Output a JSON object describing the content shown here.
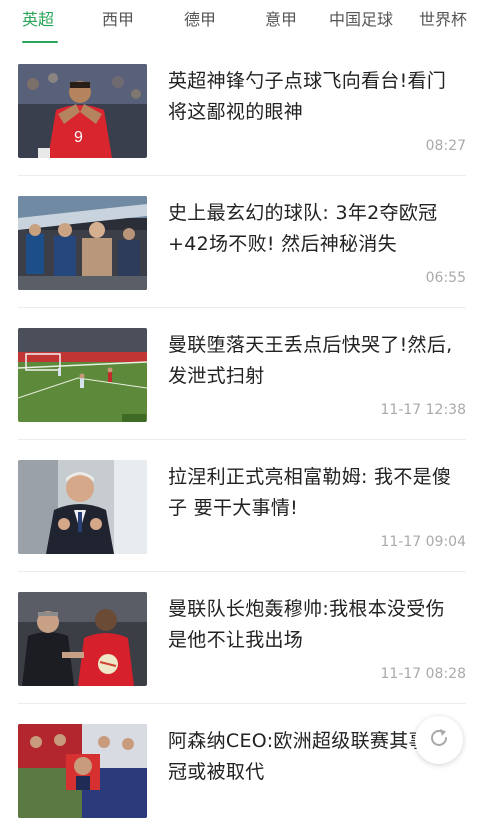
{
  "tabs": [
    {
      "label": "英超",
      "active": true
    },
    {
      "label": "西甲",
      "active": false
    },
    {
      "label": "德甲",
      "active": false
    },
    {
      "label": "意甲",
      "active": false
    },
    {
      "label": "中国足球",
      "active": false
    },
    {
      "label": "世界杯",
      "active": false
    }
  ],
  "colors": {
    "accent": "#2aa55a",
    "divider": "#ececec",
    "time": "#aaaaaa"
  },
  "articles": [
    {
      "title": "英超神锋勺子点球飞向看台!看门将这鄙视的眼神",
      "time": "08:27",
      "thumb": "player-red-jersey-9"
    },
    {
      "title": "史上最玄幻的球队: 3年2夺欧冠+42场不败! 然后神秘消失",
      "time": "06:55",
      "thumb": "coaches-bench"
    },
    {
      "title": "曼联堕落天王丢点后快哭了!然后, 发泄式扫射",
      "time": "11-17 12:38",
      "thumb": "penalty-kick-pitch"
    },
    {
      "title": "拉涅利正式亮相富勒姆: 我不是傻子 要干大事情!",
      "time": "11-17 09:04",
      "thumb": "manager-suit"
    },
    {
      "title": "曼联队长炮轰穆帅:我根本没受伤 是他不让我出场",
      "time": "11-17 08:28",
      "thumb": "manager-and-player"
    },
    {
      "title": "阿森纳CEO:欧洲超级联赛其事 欧冠或被取代",
      "time": "",
      "thumb": "collage"
    }
  ],
  "refresh_icon": "refresh-icon"
}
